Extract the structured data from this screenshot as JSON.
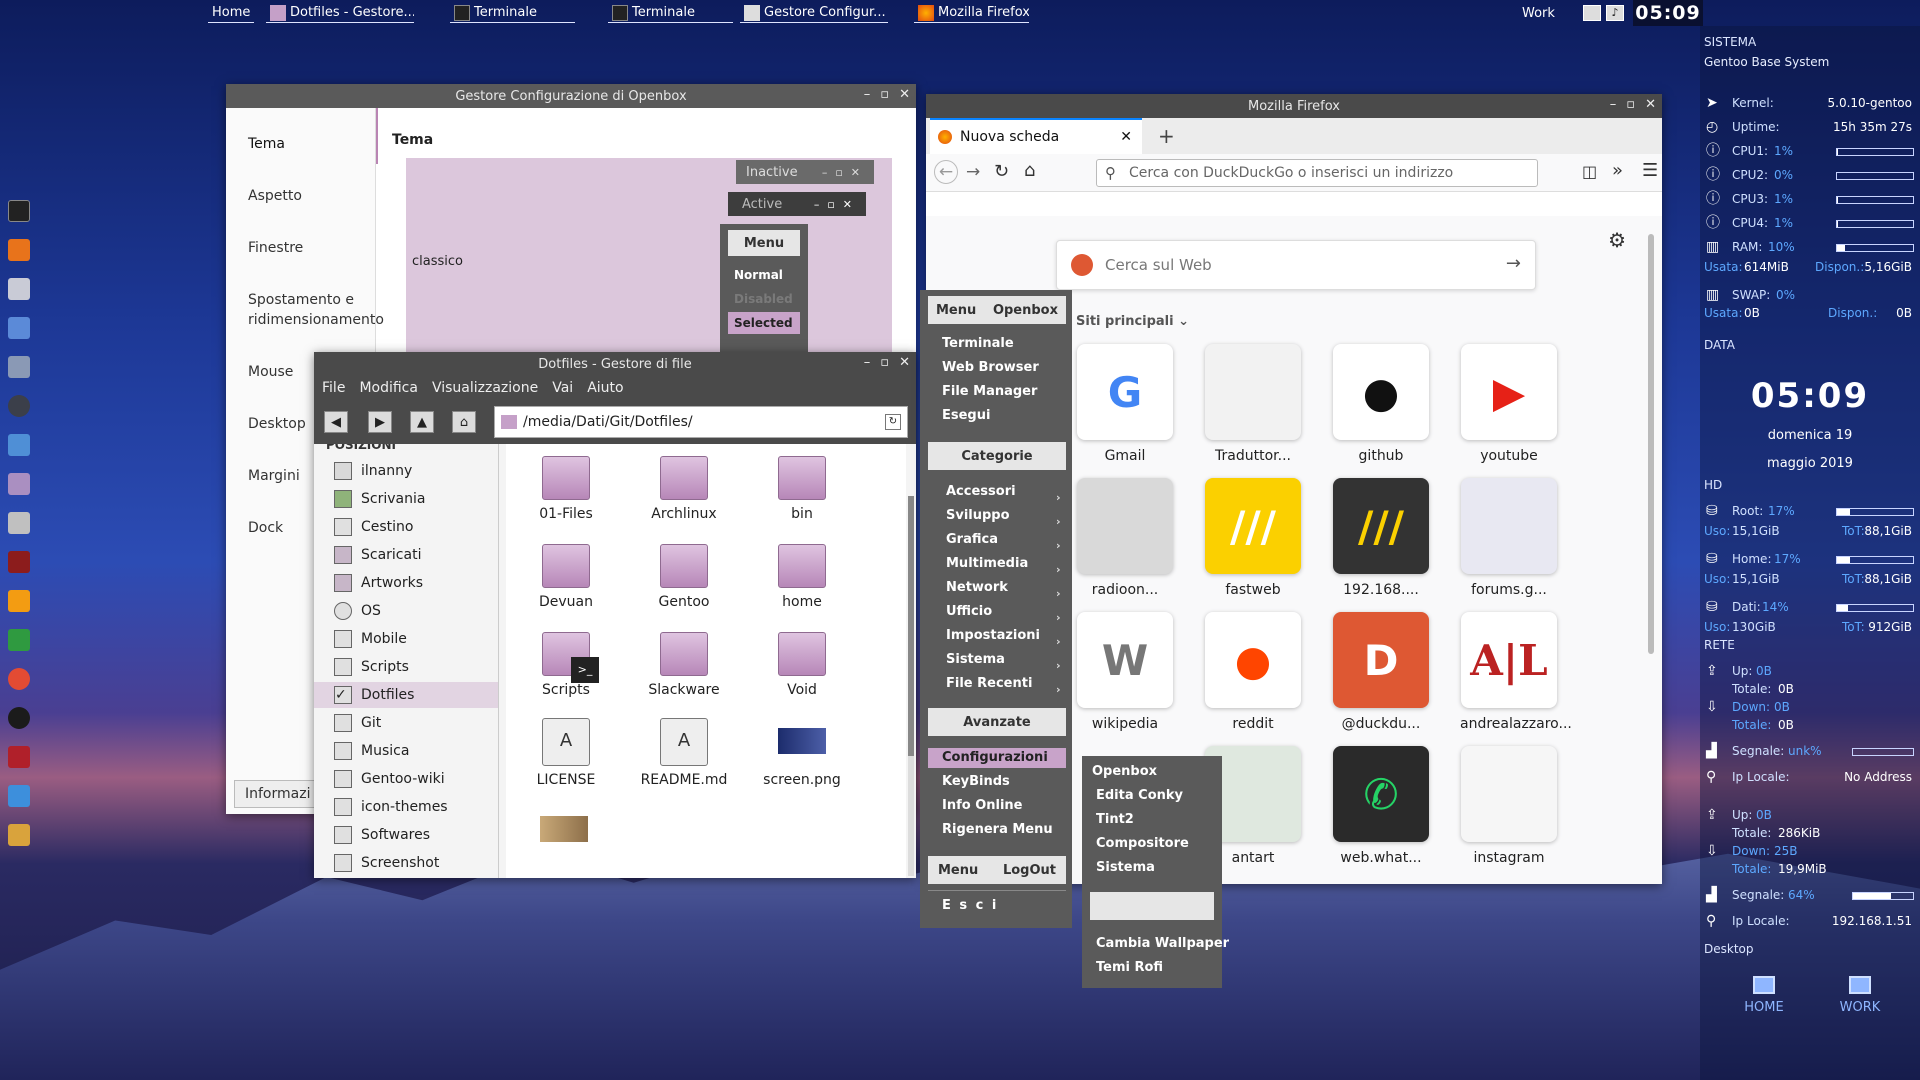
{
  "taskbar": {
    "home": "Home",
    "items": [
      "Dotfiles - Gestore...",
      "Terminale",
      "Terminale",
      "Gestore Configur...",
      "Mozilla Firefox"
    ],
    "work": "Work",
    "clock": "05:09"
  },
  "conky": {
    "sistema": "SISTEMA",
    "sistema_name": "Gentoo Base System",
    "kernel_lbl": "Kernel:",
    "kernel": "5.0.10-gentoo",
    "uptime_lbl": "Uptime:",
    "uptime": "15h 35m 27s",
    "cpu": [
      {
        "lbl": "CPU1:",
        "pct": "1%",
        "fill": 0.01
      },
      {
        "lbl": "CPU2:",
        "pct": "0%",
        "fill": 0.0
      },
      {
        "lbl": "CPU3:",
        "pct": "1%",
        "fill": 0.01
      },
      {
        "lbl": "CPU4:",
        "pct": "1%",
        "fill": 0.01
      }
    ],
    "ram_lbl": "RAM:",
    "ram_pct": "10%",
    "ram_fill": 0.1,
    "ram_used_lbl": "Usata:",
    "ram_used": "614MiB",
    "ram_free_lbl": "Dispon.:",
    "ram_free": "5,16GiB",
    "swap_lbl": "SWAP:",
    "swap_pct": "0%",
    "swap_used_lbl": "Usata:",
    "swap_used": "0B",
    "swap_free_lbl": "Dispon.:",
    "swap_free": "0B",
    "data": "DATA",
    "time": "05:09",
    "day": "domenica 19",
    "month": "maggio 2019",
    "hd": "HD",
    "disks": [
      {
        "lbl": "Root:",
        "pct": "17%",
        "fill": 0.17,
        "uso_lbl": "Uso:",
        "uso": "15,1GiB",
        "tot_lbl": "ToT:",
        "tot": "88,1GiB"
      },
      {
        "lbl": "Home:",
        "pct": "17%",
        "fill": 0.17,
        "uso_lbl": "Uso:",
        "uso": "15,1GiB",
        "tot_lbl": "ToT:",
        "tot": "88,1GiB"
      },
      {
        "lbl": "Dati:",
        "pct": "14%",
        "fill": 0.14,
        "uso_lbl": "Uso:",
        "uso": "130GiB",
        "tot_lbl": "ToT:",
        "tot": "912GiB"
      }
    ],
    "rete": "RETE",
    "net1": {
      "up_lbl": "Up:",
      "up": "0B",
      "tot_up_lbl": "Totale:",
      "tot_up": "0B",
      "down_lbl": "Down:",
      "down": "0B",
      "tot_down_lbl": "Totale:",
      "tot_down": "0B",
      "sig_lbl": "Segnale:",
      "sig": "unk%",
      "ip_lbl": "Ip Locale:",
      "ip": "No Address"
    },
    "net2": {
      "up_lbl": "Up:",
      "up": "0B",
      "tot_up_lbl": "Totale:",
      "tot_up": "286KiB",
      "down_lbl": "Down:",
      "down": "25B",
      "tot_down_lbl": "Totale:",
      "tot_down": "19,9MiB",
      "sig_lbl": "Segnale:",
      "sig": "64%",
      "sig_fill": 0.64,
      "ip_lbl": "Ip Locale:",
      "ip": "192.168.1.51"
    },
    "desktop": "Desktop",
    "desk1": "HOME",
    "desk2": "WORK"
  },
  "obconf": {
    "title": "Gestore Configurazione di Openbox",
    "side": [
      "Tema",
      "Aspetto",
      "Finestre",
      "Spostamento e",
      "ridimensionamento",
      "Mouse",
      "Desktop",
      "Margini",
      "Dock"
    ],
    "info": "Informazi",
    "heading": "Tema",
    "theme_name": "classico",
    "prev_inactive": "Inactive",
    "prev_active": "Active",
    "prev_menu": "Menu",
    "prev_normal": "Normal",
    "prev_disabled": "Disabled",
    "prev_selected": "Selected"
  },
  "fm": {
    "title": "Dotfiles - Gestore di file",
    "menu": [
      "File",
      "Modifica",
      "Visualizzazione",
      "Vai",
      "Aiuto"
    ],
    "path": "/media/Dati/Git/Dotfiles/",
    "places_header": "POSIZIONI",
    "places": [
      "ilnanny",
      "Scrivania",
      "Cestino",
      "Scaricati",
      "Artworks",
      "OS",
      "Mobile",
      "Scripts",
      "Dotfiles",
      "Git",
      "Musica",
      "Gentoo-wiki",
      "icon-themes",
      "Softwares",
      "Screenshot"
    ],
    "files": [
      "01-Files",
      "Archlinux",
      "bin",
      "Devuan",
      "Gentoo",
      "home",
      "Scripts",
      "Slackware",
      "Void",
      "LICENSE",
      "README.md",
      "screen.png"
    ]
  },
  "obmenu": {
    "h1a": "Menu",
    "h1b": "Openbox",
    "main": [
      "Terminale",
      "Web Browser",
      "File Manager",
      "Esegui"
    ],
    "h2": "Categorie",
    "cats": [
      "Accessori",
      "Sviluppo",
      "Grafica",
      "Multimedia",
      "Network",
      "Ufficio",
      "Impostazioni",
      "Sistema",
      "File  Recenti"
    ],
    "h3": "Avanzate",
    "adv": [
      "Configurazioni",
      "KeyBinds",
      "Info   Online",
      "Rigenera   Menu"
    ],
    "h4a": "Menu",
    "h4b": "LogOut",
    "esci": "E s c i",
    "sub": [
      "Openbox",
      "Edita Conky",
      "Tint2",
      "Compositore",
      "Sistema",
      "Cambia Wallpaper",
      "Temi Rofi"
    ]
  },
  "firefox": {
    "title": "Mozilla Firefox",
    "tab": "Nuova scheda",
    "url_placeholder": "Cerca con DuckDuckGo o inserisci un indirizzo",
    "search_placeholder": "Cerca sul Web",
    "top_sites": "Siti principali",
    "tiles": [
      "Gmail",
      "Traduttor...",
      "github",
      "youtube",
      "radioon...",
      "fastweb",
      "192.168....",
      "forums.g...",
      "wikipedia",
      "reddit",
      "@duckdu...",
      "andrealazzaro...",
      "antart",
      "web.what...",
      "instagram"
    ]
  }
}
